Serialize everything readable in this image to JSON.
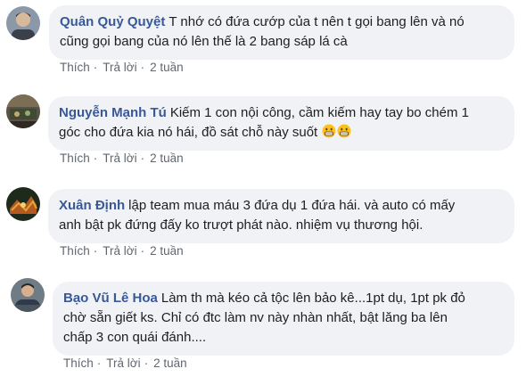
{
  "comments": [
    {
      "author": "Quân Quỷ Quyệt",
      "text_line1": "T nhớ có đứa cướp của t nên t gọi bang lên và nó",
      "text_line2": "cũng gọi bang của nó lên thế là 2 bang sáp lá cà",
      "like": "Thích",
      "reply": "Trả lời",
      "time": "2 tuần"
    },
    {
      "author": "Nguyễn Mạnh Tú",
      "text_line1": "Kiếm 1 con nội công, cầm kiếm hay tay bo chém 1",
      "text_line2": "góc cho đứa kia nó hái, đồ sát chỗ này suốt",
      "emojis": [
        "grimace-emoji",
        "grimace-emoji"
      ],
      "like": "Thích",
      "reply": "Trả lời",
      "time": "2 tuần"
    },
    {
      "author": "Xuân Định",
      "text_line1": "lập team mua máu 3 đứa dụ 1 đứa hái. và auto có mấy",
      "text_line2": "anh bật pk đứng đấy ko trượt phát nào. nhiệm vụ thương hội.",
      "like": "Thích",
      "reply": "Trả lời",
      "time": "2 tuần"
    },
    {
      "author": "Bạo Vũ Lê Hoa",
      "text_line1": "Làm th mà kéo cả tộc lên bảo kê...1pt dụ, 1pt pk đỏ",
      "text_line2": "chờ sẵn giết ks. Chỉ có đtc làm nv này nhàn nhất, bật lăng ba lên",
      "text_line3": "chấp 3 con quái đánh....",
      "like": "Thích",
      "reply": "Trả lời",
      "time": "2 tuần"
    }
  ]
}
